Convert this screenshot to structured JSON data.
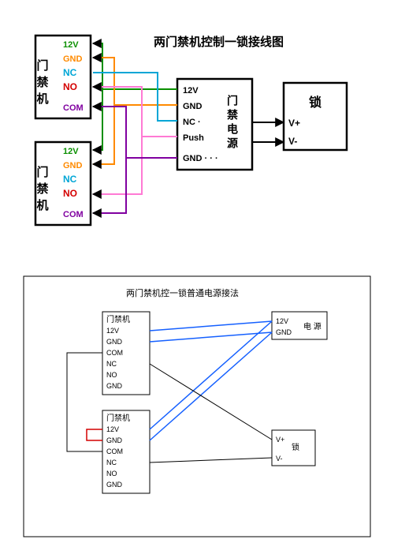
{
  "top": {
    "title": "两门禁机控制一锁接线图",
    "accessTerminalA": {
      "label": "门禁机",
      "pins": {
        "v12": "12V",
        "gnd": "GND",
        "nc": "NC",
        "no": "NO",
        "com": "COM"
      }
    },
    "accessTerminalB": {
      "label": "门禁机",
      "pins": {
        "v12": "12V",
        "gnd": "GND",
        "nc": "NC",
        "no": "NO",
        "com": "COM"
      }
    },
    "controller": {
      "label": "门禁电源",
      "pins": {
        "v12": "12V",
        "gnd": "GND",
        "nc": "NC · ",
        "push": "Push",
        "gnd2": "GND · · ·"
      }
    },
    "lock": {
      "label": "锁",
      "pins": {
        "vp": "V+",
        "vn": "V-"
      }
    },
    "colors": {
      "green": "#0a8f00",
      "orange": "#ff8a00",
      "cyan": "#00a6d6",
      "pink": "#ff7ad4",
      "purple": "#8000a0",
      "red": "#d40000",
      "black": "#000000"
    }
  },
  "bottom": {
    "title": "两门禁机控一锁普通电源接法",
    "accessTerminalA": {
      "label": "门禁机",
      "pins": [
        "12V",
        "GND",
        "COM",
        "NC",
        "NO",
        "GND"
      ]
    },
    "accessTerminalB": {
      "label": "门禁机",
      "pins": [
        "12V",
        "GND",
        "COM",
        "NC",
        "NO",
        "GND"
      ]
    },
    "power": {
      "label": "电 源",
      "pins": [
        "12V",
        "GND"
      ]
    },
    "lock": {
      "label": "锁",
      "pins": [
        "V+",
        "V-"
      ]
    }
  }
}
